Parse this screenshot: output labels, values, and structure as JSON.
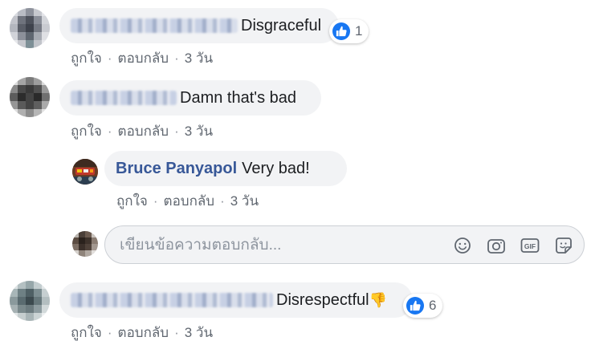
{
  "comments": [
    {
      "author": "",
      "text": "Disgraceful",
      "reaction_count": "1"
    },
    {
      "author": "",
      "text": "Damn that's bad"
    },
    {
      "author": "Bruce Panyapol",
      "text": "Very bad!"
    },
    {
      "author": "",
      "text": "Disrespectful",
      "emoji": "👎",
      "reaction_count": "6"
    }
  ],
  "actions": {
    "like": "ถูกใจ",
    "reply": "ตอบกลับ",
    "time": "3 วัน",
    "separator": "·"
  },
  "reply_input": {
    "placeholder": "เขียนข้อความตอบกลับ..."
  },
  "icons": {
    "like": "thumbs-up-icon",
    "emoji": "smiley-icon",
    "camera": "camera-icon",
    "gif": "gif-icon",
    "sticker": "sticker-icon"
  },
  "colors": {
    "author_link": "#385898",
    "like_blue": "#1877f2",
    "bubble_bg": "#f2f3f5",
    "meta_text": "#606770"
  }
}
